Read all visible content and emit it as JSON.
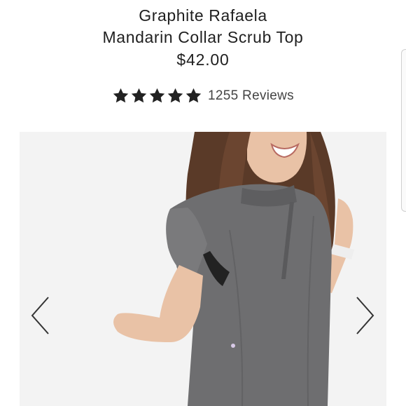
{
  "product": {
    "title_line1": "Graphite Rafaela",
    "title_line2": "Mandarin Collar Scrub Top",
    "price": "$42.00"
  },
  "rating": {
    "stars": 5,
    "max": 5,
    "reviews_label": "1255 Reviews",
    "star_icon": "star-icon"
  },
  "gallery": {
    "prev_icon": "chevron-left-icon",
    "next_icon": "chevron-right-icon",
    "background": "#f3f3f3",
    "garment_color": "#6b6b6d"
  },
  "colors": {
    "text": "#1f1f1f",
    "star": "#222222"
  }
}
